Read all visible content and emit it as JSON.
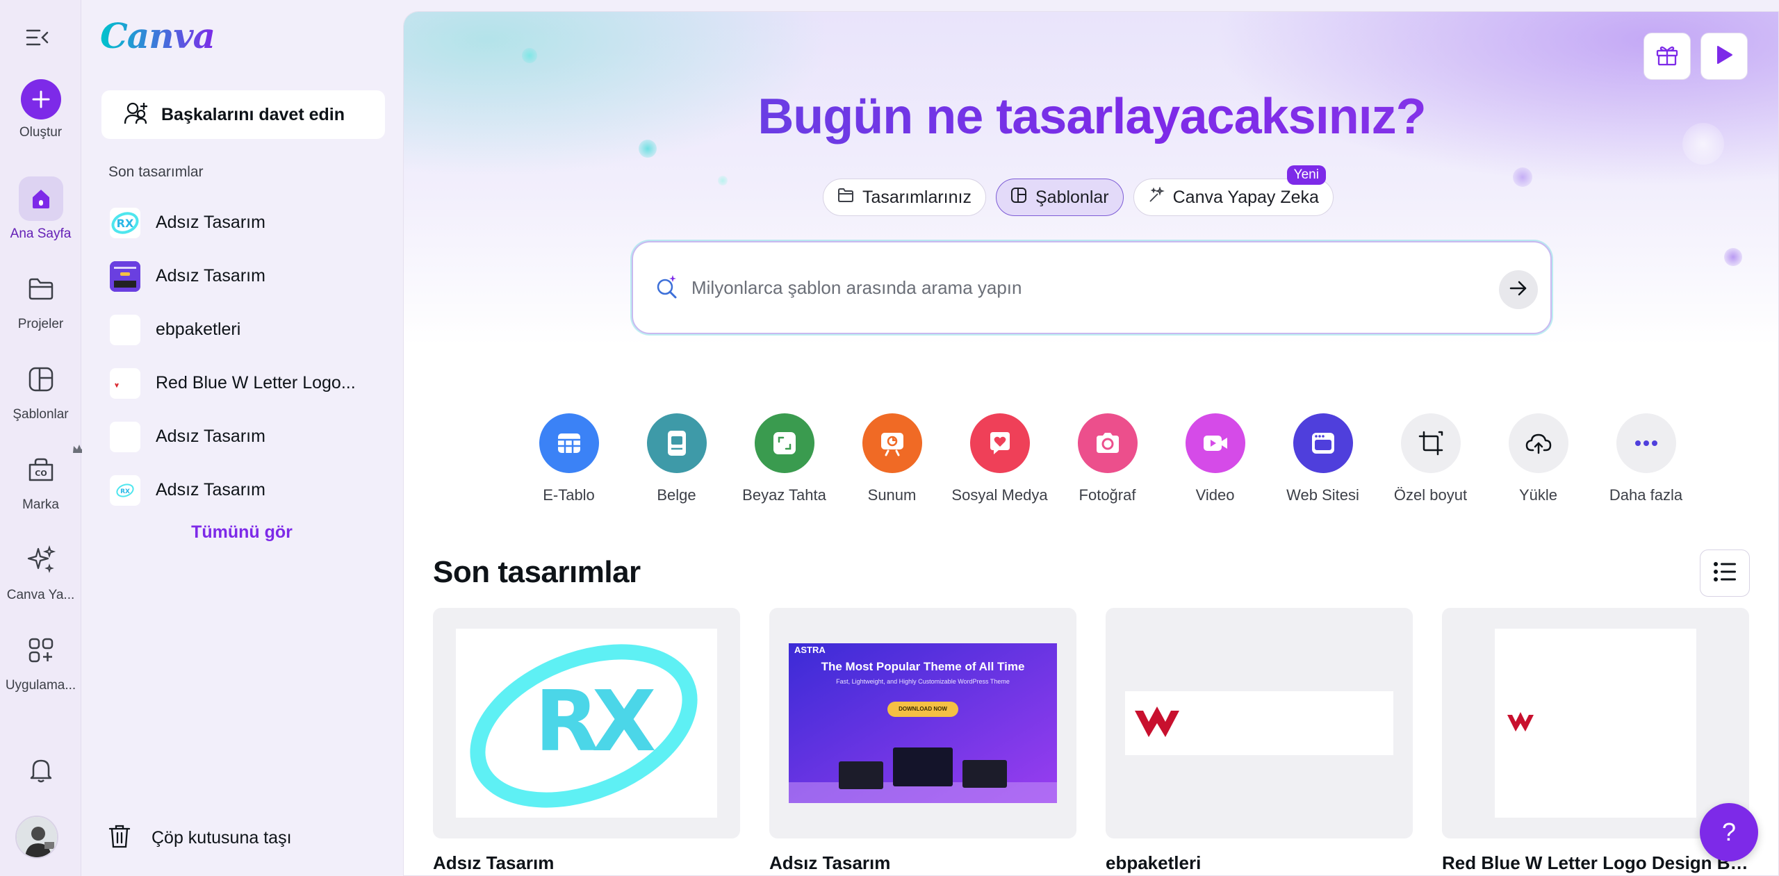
{
  "rail": {
    "create_label": "Oluştur",
    "items": [
      {
        "label": "Ana Sayfa",
        "icon": "home-icon"
      },
      {
        "label": "Projeler",
        "icon": "folder-icon"
      },
      {
        "label": "Şablonlar",
        "icon": "templates-icon"
      },
      {
        "label": "Marka",
        "icon": "brand-icon"
      },
      {
        "label": "Canva Ya...",
        "icon": "magic-sparkle-icon"
      },
      {
        "label": "Uygulama...",
        "icon": "apps-icon"
      }
    ]
  },
  "panel": {
    "logo": "Canva",
    "invite_label": "Başkalarını davet edin",
    "recent_label": "Son tasarımlar",
    "recent": [
      {
        "name": "Adsız Tasarım"
      },
      {
        "name": "Adsız Tasarım"
      },
      {
        "name": "ebpaketleri"
      },
      {
        "name": "Red Blue W Letter Logo..."
      },
      {
        "name": "Adsız Tasarım"
      },
      {
        "name": "Adsız Tasarım"
      }
    ],
    "see_all": "Tümünü gör",
    "trash_label": "Çöp kutusuna taşı"
  },
  "main": {
    "title": "Bugün ne tasarlayacaksınız?",
    "chips": [
      {
        "label": "Tasarımlarınız"
      },
      {
        "label": "Şablonlar"
      },
      {
        "label": "Canva Yapay Zeka",
        "badge": "Yeni"
      }
    ],
    "search_placeholder": "Milyonlarca şablon arasında arama yapın",
    "categories": [
      {
        "label": "E-Tablo",
        "color": "#3b82f6"
      },
      {
        "label": "Belge",
        "color": "#3e9aa8"
      },
      {
        "label": "Beyaz Tahta",
        "color": "#3a9b4f"
      },
      {
        "label": "Sunum",
        "color": "#f06a25"
      },
      {
        "label": "Sosyal Medya",
        "color": "#ef4058"
      },
      {
        "label": "Fotoğraf",
        "color": "#ec4f8c"
      },
      {
        "label": "Video",
        "color": "#d54be8"
      },
      {
        "label": "Web Sitesi",
        "color": "#4f3fdc"
      },
      {
        "label": "Özel boyut",
        "color": "#eeeef1"
      },
      {
        "label": "Yükle",
        "color": "#eeeef1"
      },
      {
        "label": "Daha fazla",
        "color": "#eeeef1"
      }
    ],
    "section_title": "Son tasarımlar",
    "designs": [
      {
        "name": "Adsız Tasarım"
      },
      {
        "name": "Adsız Tasarım",
        "thumb_heading": "The Most Popular Theme of All Time",
        "thumb_sub": "Fast, Lightweight, and Highly Customizable WordPress Theme",
        "thumb_brand": "ASTRA",
        "thumb_button": "DOWNLOAD NOW"
      },
      {
        "name": "ebpaketleri"
      },
      {
        "name": "Red Blue W Letter Logo Design Bu..."
      }
    ],
    "help": "?"
  },
  "colors": {
    "accent": "#7d2ae8",
    "teal": "#00c4cc"
  }
}
